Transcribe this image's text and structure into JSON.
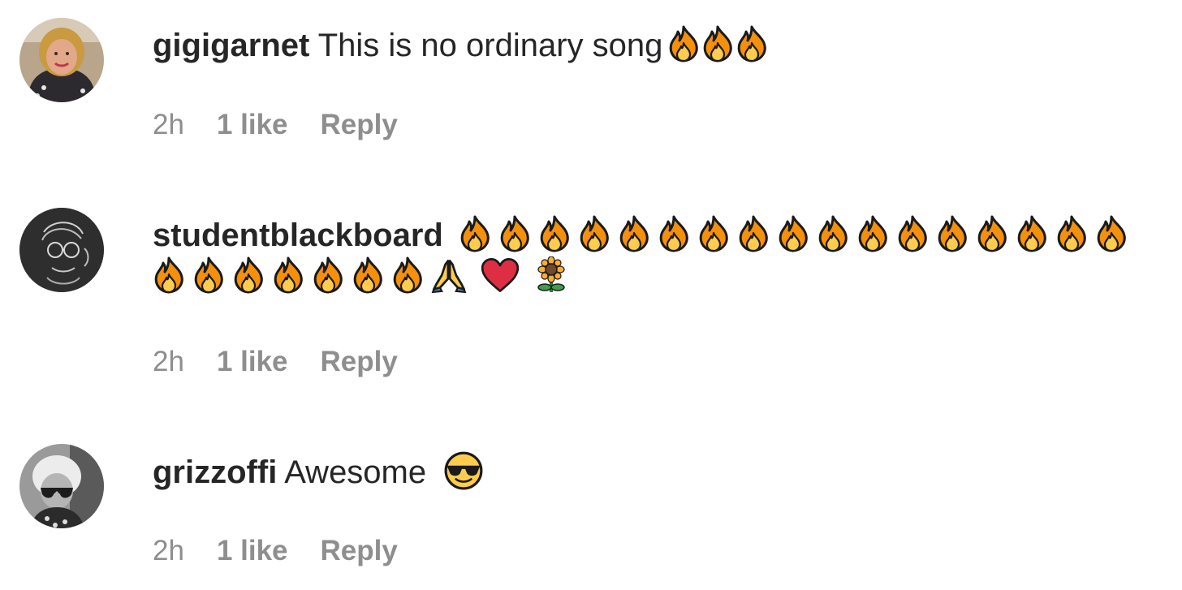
{
  "comments": [
    {
      "username": "gigigarnet",
      "text": "This is no ordinary song",
      "emojis": [
        "fire-emoji",
        "fire-emoji",
        "fire-emoji"
      ],
      "time": "2h",
      "likes": "1 like",
      "reply_label": "Reply"
    },
    {
      "username": "studentblackboard",
      "text": "",
      "emojis_line1": [
        "fire-emoji",
        "fire-emoji",
        "fire-emoji",
        "fire-emoji",
        "fire-emoji",
        "fire-emoji",
        "fire-emoji",
        "fire-emoji",
        "fire-emoji",
        "fire-emoji",
        "fire-emoji",
        "fire-emoji",
        "fire-emoji",
        "fire-emoji",
        "fire-emoji",
        "fire-emoji",
        "fire-emoji"
      ],
      "emojis_line2": [
        "fire-emoji",
        "fire-emoji",
        "fire-emoji",
        "fire-emoji",
        "fire-emoji",
        "fire-emoji",
        "fire-emoji",
        "folded-hands-emoji",
        "red-heart-emoji",
        "sunflower-emoji"
      ],
      "time": "2h",
      "likes": "1 like",
      "reply_label": "Reply"
    },
    {
      "username": "grizzoffi",
      "text": "Awesome",
      "emojis": [
        "sunglasses-face-emoji"
      ],
      "time": "2h",
      "likes": "1 like",
      "reply_label": "Reply"
    }
  ],
  "colors": {
    "text": "#262626",
    "meta": "#8e8e8e",
    "background": "#ffffff"
  }
}
